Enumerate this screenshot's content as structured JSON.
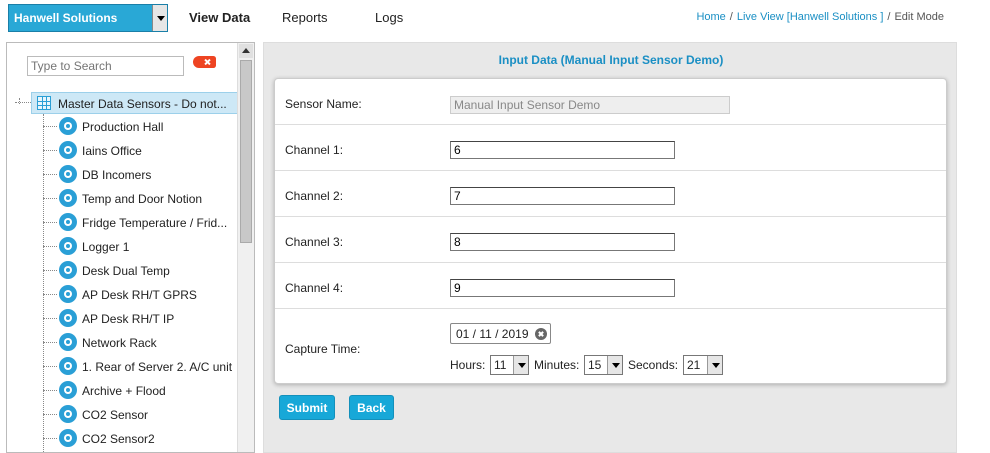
{
  "header": {
    "org_selector": "Hanwell Solutions",
    "nav": [
      "View Data",
      "Reports",
      "Logs"
    ],
    "breadcrumb": {
      "home": "Home",
      "live_view": "Live View [Hanwell Solutions ]",
      "current": "Edit Mode",
      "separator": "/"
    }
  },
  "sidebar": {
    "search_placeholder": "Type to Search",
    "root": "Master Data Sensors - Do not...",
    "items": [
      "Production Hall",
      "Iains Office",
      "DB Incomers",
      "Temp and Door Notion",
      "Fridge Temperature / Frid...",
      "Logger 1",
      "Desk Dual Temp",
      "AP Desk RH/T GPRS",
      "AP Desk RH/T IP",
      "Network Rack",
      "1. Rear of Server 2. A/C unit",
      "Archive + Flood",
      "CO2 Sensor",
      "CO2 Sensor2"
    ]
  },
  "form": {
    "title": "Input Data (Manual Input Sensor Demo)",
    "sensor_name_label": "Sensor Name:",
    "sensor_name_value": "Manual Input Sensor Demo",
    "channels": [
      {
        "label": "Channel 1:",
        "value": "6"
      },
      {
        "label": "Channel 2:",
        "value": "7"
      },
      {
        "label": "Channel 3:",
        "value": "8"
      },
      {
        "label": "Channel 4:",
        "value": "9"
      }
    ],
    "capture_time_label": "Capture Time:",
    "date_value": "01 / 11 / 2019",
    "hours_label": "Hours:",
    "hours_value": "11",
    "minutes_label": "Minutes:",
    "minutes_value": "15",
    "seconds_label": "Seconds:",
    "seconds_value": "21",
    "submit_label": "Submit",
    "back_label": "Back"
  },
  "colors": {
    "accent": "#29a8d6",
    "link": "#1a8fc4",
    "clear_search": "#ee4422"
  }
}
